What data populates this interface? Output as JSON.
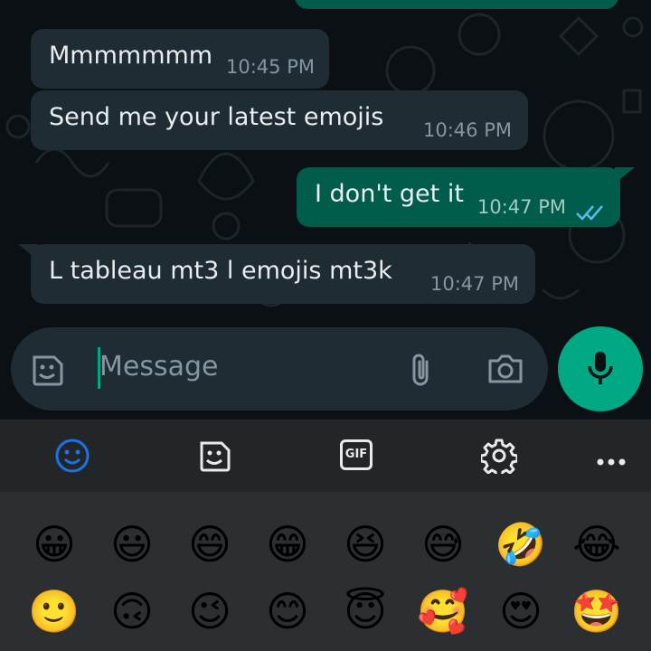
{
  "messages": [
    {
      "direction": "in",
      "text": "Mmmmmmm",
      "time": "10:45 PM"
    },
    {
      "direction": "in",
      "text": "Send me your latest emojis",
      "time": "10:46 PM"
    },
    {
      "direction": "out",
      "text": "I don't get it",
      "time": "10:47 PM",
      "status": "read"
    },
    {
      "direction": "in",
      "text": "L tableau mt3 l emojis mt3k",
      "time": "10:47 PM"
    }
  ],
  "composer": {
    "placeholder": "Message",
    "emoji_icon": "sticker-smile-icon",
    "attach_icon": "paperclip-icon",
    "camera_icon": "camera-icon",
    "mic_icon": "microphone-icon"
  },
  "keyboard": {
    "tabs": [
      {
        "name": "emoji",
        "icon": "smiley-icon",
        "active": true
      },
      {
        "name": "stickers",
        "icon": "sticker-icon"
      },
      {
        "name": "gif",
        "label": "GIF"
      },
      {
        "name": "settings",
        "icon": "gear-icon"
      },
      {
        "name": "more",
        "icon": "more-dots-icon"
      }
    ],
    "emoji_rows": [
      [
        "😀",
        "😃",
        "😄",
        "😁",
        "😆",
        "😅",
        "🤣",
        "😂"
      ],
      [
        "🙂",
        "🙃",
        "😉",
        "😊",
        "😇",
        "🥰",
        "😍",
        "🤩"
      ]
    ]
  },
  "colors": {
    "accent": "#00a884",
    "incoming_bubble": "#202c33",
    "outgoing_bubble": "#005c4b",
    "read_tick": "#53bdeb",
    "active_tab": "#1a73e8"
  }
}
